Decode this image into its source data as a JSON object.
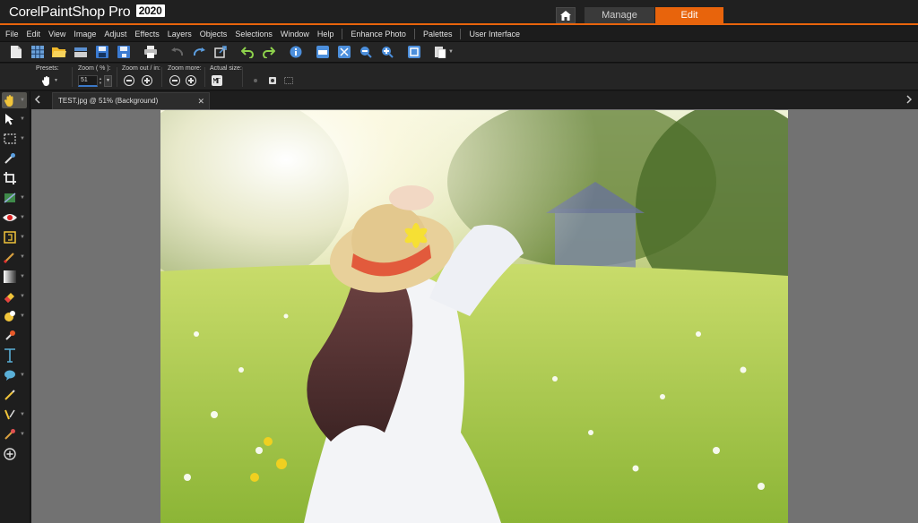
{
  "app": {
    "brand_corel": "Corel",
    "brand_product": "PaintShop Pro",
    "brand_version": "2020"
  },
  "workspace_tabs": {
    "manage": "Manage",
    "edit": "Edit"
  },
  "menu": [
    "File",
    "Edit",
    "View",
    "Image",
    "Adjust",
    "Effects",
    "Layers",
    "Objects",
    "Selections",
    "Window",
    "Help",
    "Enhance Photo",
    "Palettes",
    "User Interface"
  ],
  "options": {
    "presets_label": "Presets:",
    "zoom_label": "Zoom ( % ):",
    "zoom_value": "51",
    "zoom_out_label": "Zoom out / in:",
    "zoom_more_label": "Zoom more:",
    "actual_size_label": "Actual size:"
  },
  "document": {
    "tab_title": "TEST.jpg @  51% (Background)"
  },
  "colors": {
    "accent": "#e8640c",
    "zoom_underline": "#3a78c8"
  }
}
